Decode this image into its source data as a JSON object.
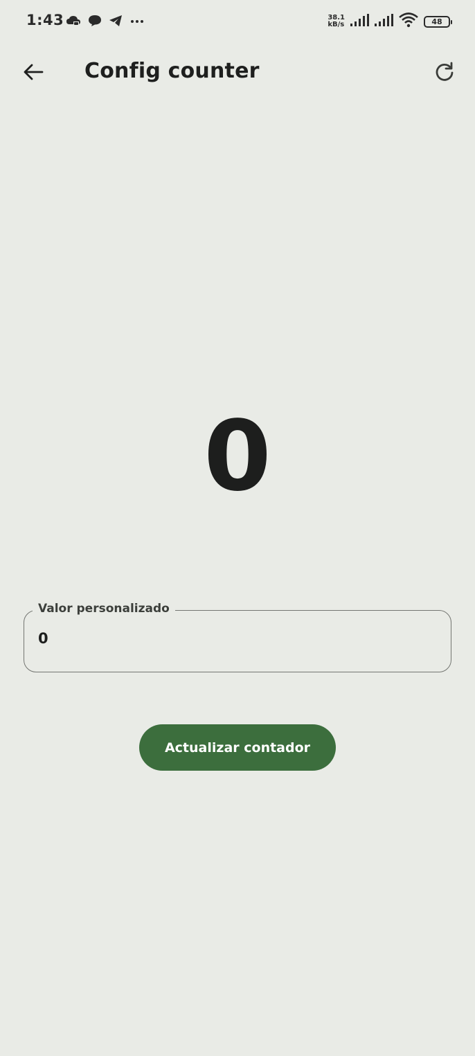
{
  "status_bar": {
    "time": "1:43",
    "net_speed_value": "38.1",
    "net_speed_unit": "kB/s",
    "battery_level": "48",
    "left_icons": [
      "cloud-icon",
      "chat-bubble-icon",
      "telegram-icon",
      "more-dots-icon"
    ],
    "right_icons": [
      "signal-icon",
      "signal-icon",
      "wifi-icon",
      "battery-icon"
    ]
  },
  "top_bar": {
    "title": "Config counter",
    "back_icon": "arrow-left-icon",
    "refresh_icon": "refresh-icon"
  },
  "counter": {
    "value": "0"
  },
  "custom_value_field": {
    "label": "Valor personalizado",
    "value": "0"
  },
  "update_button": {
    "label": "Actualizar contador"
  },
  "colors": {
    "background": "#e9ebe6",
    "primary": "#3c6e3d",
    "on_primary": "#ffffff",
    "text": "#1e1f1e",
    "outline": "#737571"
  }
}
